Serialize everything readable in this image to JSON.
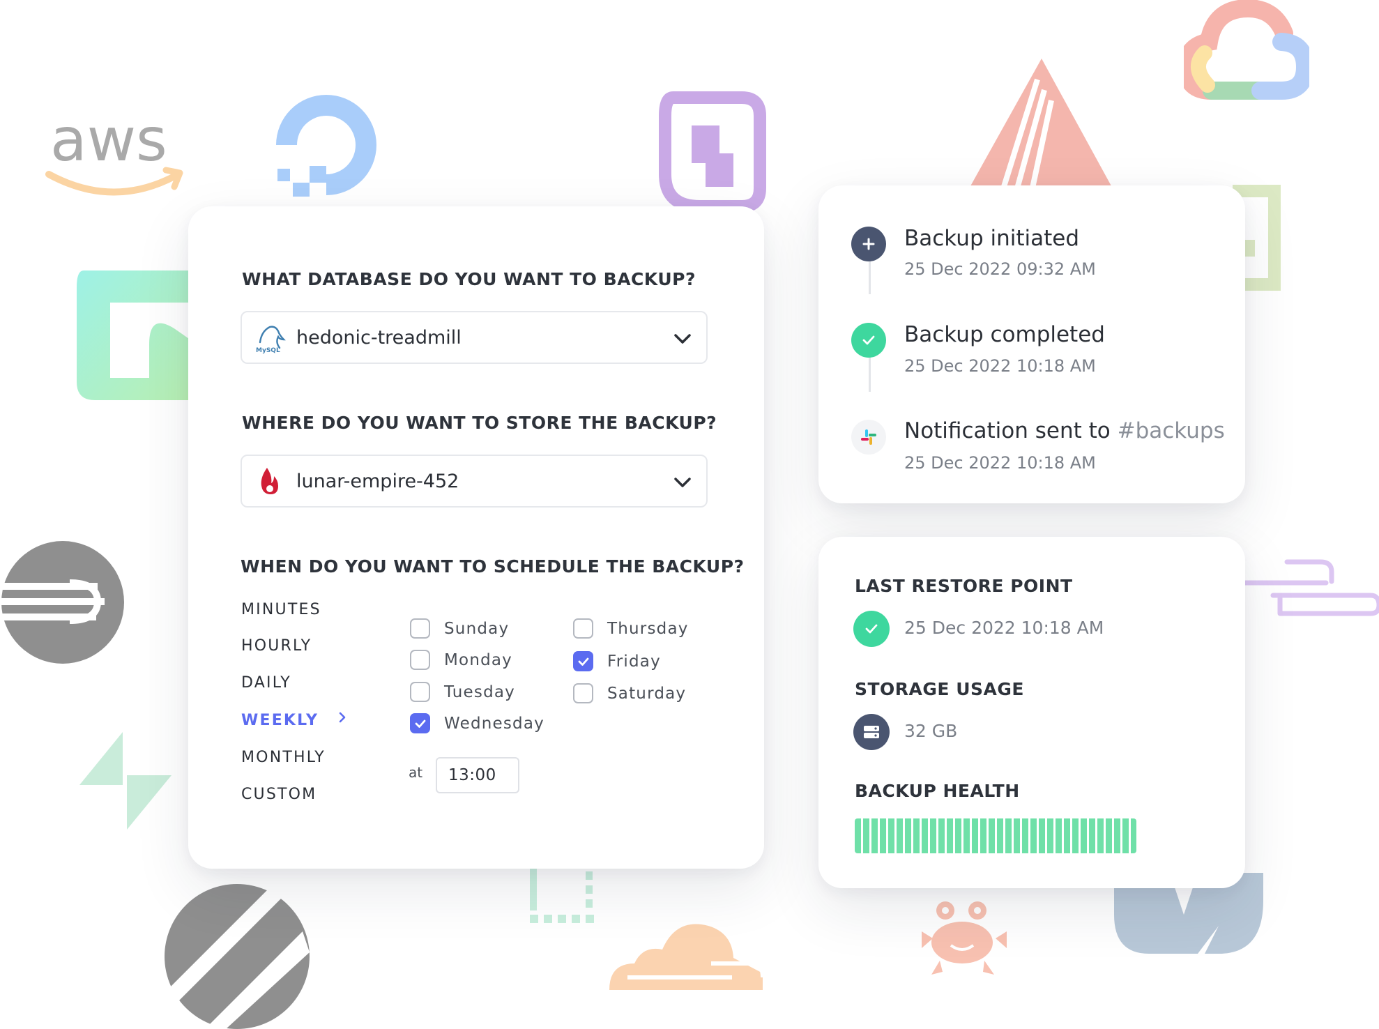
{
  "background_logos": [
    {
      "name": "aws",
      "text": "aws"
    },
    {
      "name": "digitalocean"
    },
    {
      "name": "scaleway"
    },
    {
      "name": "arch"
    },
    {
      "name": "google-cloud"
    },
    {
      "name": "neon"
    },
    {
      "name": "railway"
    },
    {
      "name": "supabase"
    },
    {
      "name": "planetscale"
    },
    {
      "name": "cloudflare"
    },
    {
      "name": "crab"
    },
    {
      "name": "vultr"
    }
  ],
  "backup_form": {
    "database_question": "WHAT DATABASE DO YOU WANT TO BACKUP?",
    "database_value": "hedonic-treadmill",
    "database_icon": "mysql-icon",
    "storage_question": "WHERE DO YOU WANT TO STORE THE BACKUP?",
    "storage_value": "lunar-empire-452",
    "storage_icon": "backblaze-icon",
    "schedule_question": "WHEN DO YOU WANT TO SCHEDULE THE BACKUP?",
    "frequencies": [
      "MINUTES",
      "HOURLY",
      "DAILY",
      "WEEKLY",
      "MONTHLY",
      "CUSTOM"
    ],
    "active_frequency": "WEEKLY",
    "days": [
      {
        "label": "Sunday",
        "checked": false
      },
      {
        "label": "Monday",
        "checked": false
      },
      {
        "label": "Tuesday",
        "checked": false
      },
      {
        "label": "Wednesday",
        "checked": true
      },
      {
        "label": "Thursday",
        "checked": false
      },
      {
        "label": "Friday",
        "checked": true
      },
      {
        "label": "Saturday",
        "checked": false
      }
    ],
    "at_label": "at",
    "time_value": "13:00"
  },
  "timeline": {
    "events": [
      {
        "title": "Backup initiated",
        "time": "25 Dec 2022 09:32 AM",
        "icon": "plus-icon",
        "color": "#4a5570"
      },
      {
        "title": "Backup completed",
        "time": "25 Dec 2022 10:18 AM",
        "icon": "check-icon",
        "color": "#3ed79e"
      },
      {
        "title": "Notification sent to",
        "channel": "#backups",
        "time": "25 Dec 2022 10:18 AM",
        "icon": "slack-icon",
        "color": "#f3f4f6"
      }
    ]
  },
  "status": {
    "restore_label": "LAST RESTORE POINT",
    "restore_value": "25 Dec 2022 10:18 AM",
    "storage_label": "STORAGE USAGE",
    "storage_value": "32 GB",
    "health_label": "BACKUP HEALTH",
    "health_percent": 100
  },
  "colors": {
    "accent": "#5b6bf0",
    "success": "#3ed79e",
    "health": "#6fe0a8",
    "dark_icon": "#4a5570"
  }
}
